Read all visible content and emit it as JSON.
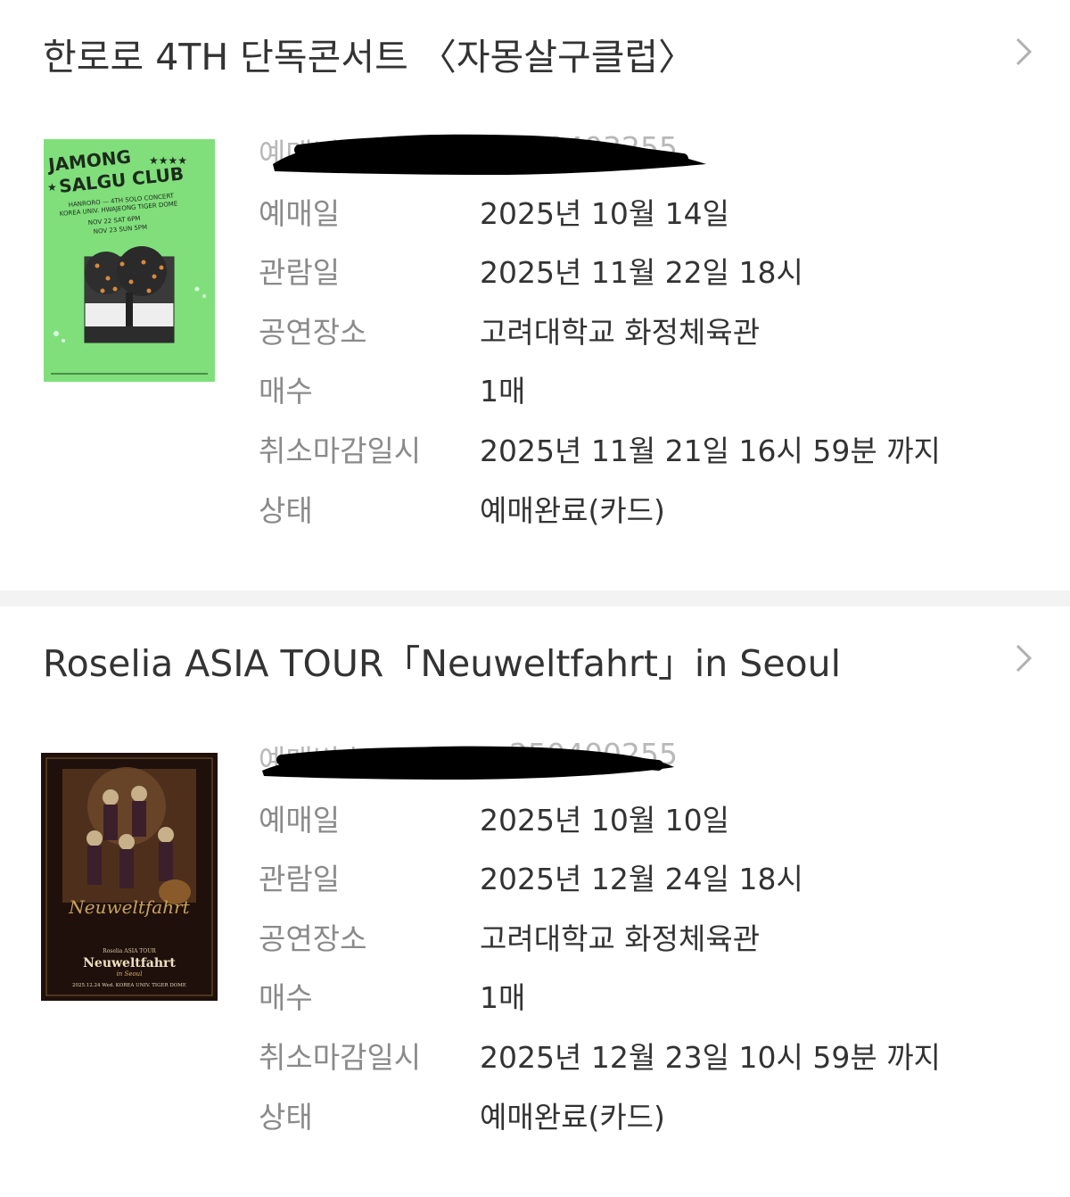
{
  "labels": {
    "booking_no": "예매번호",
    "booking_date": "예매일",
    "view_date": "관람일",
    "venue": "공연장소",
    "quantity": "매수",
    "cancel_deadline": "취소마감일시",
    "status": "상태"
  },
  "bookings": [
    {
      "title": "한로로 4TH 단독콘서트 〈자몽살구클럽〉",
      "booking_no_partial": "…250403255",
      "booking_date": "2025년 10월 14일",
      "view_date": "2025년 11월 22일 18시",
      "venue": "고려대학교 화정체육관",
      "quantity": "1매",
      "cancel_deadline": "2025년 11월 21일 16시 59분 까지",
      "status": "예매완료(카드)",
      "poster": {
        "line1": "JAMONG",
        "line2": "SALGU CLUB",
        "sub1": "HANRORO — 4TH SOLO CONCERT",
        "sub2": "KOREA UNIV. HWAJEONG TIGER DOME",
        "sub3": "NOV 22 SAT 6PM",
        "sub4": "NOV 23 SUN 5PM",
        "bg_color": "#7ee07a"
      }
    },
    {
      "title": "Roselia ASIA TOUR「Neuweltfahrt」in Seoul",
      "booking_no_partial": "…250400255",
      "booking_date": "2025년 10월 10일",
      "view_date": "2025년 12월 24일 18시",
      "venue": "고려대학교 화정체육관",
      "quantity": "1매",
      "cancel_deadline": "2025년 12월 23일 10시 59분 까지",
      "status": "예매완료(카드)",
      "poster": {
        "small": "Roselia ASIA TOUR",
        "big": "Neuweltfahrt",
        "script": "in Seoul",
        "date_line": "2025.12.24 Wed.  KOREA UNIV. TIGER DOME",
        "bg_color": "#2a1410"
      }
    }
  ],
  "icons": {
    "detail": "chevron-right-icon"
  }
}
